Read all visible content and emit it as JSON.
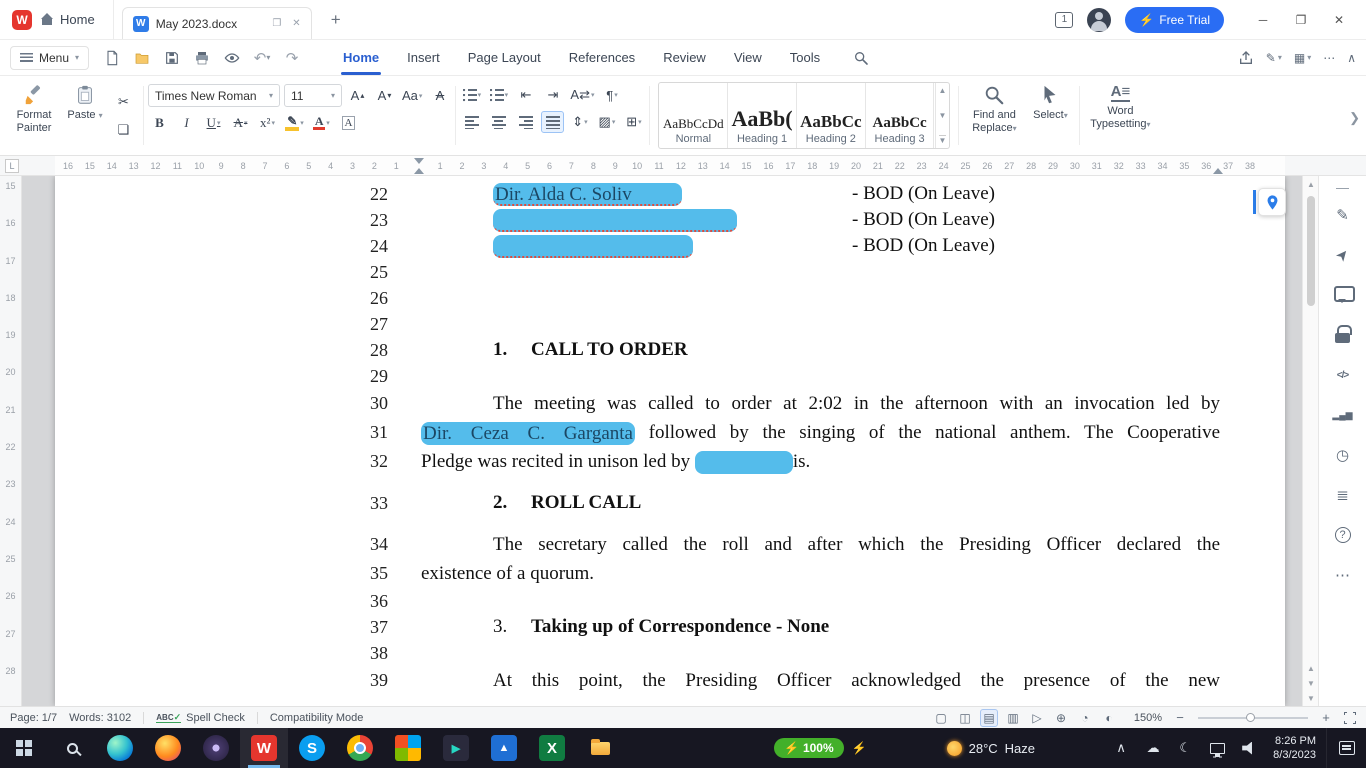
{
  "titlebar": {
    "workspace_tab_label": "Home",
    "document_tab_title": "May 2023.docx",
    "session_badge": "1",
    "free_trial_label": "Free Trial"
  },
  "menubar": {
    "menu_label": "Menu",
    "tabs": [
      {
        "label": "Home",
        "active": true
      },
      {
        "label": "Insert"
      },
      {
        "label": "Page Layout"
      },
      {
        "label": "References"
      },
      {
        "label": "Review"
      },
      {
        "label": "View"
      },
      {
        "label": "Tools"
      }
    ]
  },
  "ribbon": {
    "format_painter_label": "Format Painter",
    "paste_label": "Paste",
    "font_name_value": "Times New Roman",
    "font_size_value": "11",
    "styles": [
      {
        "preview": "AaBbCcDd",
        "label": "Normal"
      },
      {
        "preview": "AaBb(",
        "label": "Heading 1"
      },
      {
        "preview": "AaBbCc",
        "label": "Heading 2"
      },
      {
        "preview": "AaBbCc",
        "label": "Heading 3"
      }
    ],
    "find_replace_label": "Find and Replace",
    "select_label": "Select",
    "word_typesetting_label": "Word Typesetting"
  },
  "ruler": {
    "horizontal_numbers": [
      "16",
      "15",
      "14",
      "13",
      "12",
      "11",
      "10",
      "9",
      "8",
      "7",
      "6",
      "5",
      "4",
      "3",
      "2",
      "1",
      "",
      "1",
      "2",
      "3",
      "4",
      "5",
      "6",
      "7",
      "8",
      "9",
      "10",
      "11",
      "12",
      "13",
      "14",
      "15",
      "16",
      "17",
      "18",
      "19",
      "20",
      "21",
      "22",
      "23",
      "24",
      "25",
      "26",
      "27",
      "28",
      "29",
      "30",
      "31",
      "32",
      "33",
      "34",
      "35",
      "36",
      "37",
      "38"
    ],
    "vertical_numbers": [
      "15",
      "16",
      "17",
      "18",
      "19",
      "20",
      "21",
      "22",
      "23",
      "24",
      "25",
      "26",
      "27",
      "28"
    ]
  },
  "document": {
    "lines": [
      {
        "num": "22",
        "type": "roster",
        "text": "Dir. Alda C. Soliv",
        "hl_width": 189,
        "right": "- BOD (On Leave)",
        "squiggle": true
      },
      {
        "num": "23",
        "type": "roster",
        "text": "",
        "hl_width": 244,
        "right": "- BOD (On Leave)",
        "squiggle": true
      },
      {
        "num": "24",
        "type": "roster",
        "text": "",
        "hl_width": 200,
        "right": "- BOD (On Leave)",
        "squiggle": true
      },
      {
        "num": "25",
        "type": "empty"
      },
      {
        "num": "26",
        "type": "empty"
      },
      {
        "num": "27",
        "type": "empty"
      },
      {
        "num": "28",
        "type": "heading",
        "number": "1.",
        "text": "CALL TO ORDER"
      },
      {
        "num": "29",
        "type": "empty"
      },
      {
        "num": "30",
        "type": "body-first",
        "text": "The meeting was called to order at 2:02 in the afternoon with an invocation led by"
      },
      {
        "num": "31",
        "type": "body",
        "segments": [
          {
            "text": "Dir. Ceza C. Garganta",
            "hl": true,
            "hl_width": 214
          },
          {
            "text": " followed by the singing of the national anthem. The Cooperative"
          }
        ]
      },
      {
        "num": "32",
        "type": "body-last",
        "segments": [
          {
            "text": "Pledge was recited in unison led by "
          },
          {
            "text": "",
            "hl": true,
            "hl_width": 98
          },
          {
            "text": "is."
          }
        ]
      },
      {
        "num": "33",
        "type": "heading",
        "number": "2.",
        "text": "ROLL CALL",
        "gap_before": true
      },
      {
        "num": "34",
        "type": "body-first",
        "text": "The secretary called the roll and after which the Presiding Officer declared the",
        "gap_before": true
      },
      {
        "num": "35",
        "type": "body-last",
        "text": "existence of a quorum."
      },
      {
        "num": "36",
        "type": "empty"
      },
      {
        "num": "37",
        "type": "heading",
        "number": "3.",
        "text": "Taking up of Correspondence - None",
        "number_bold": false
      },
      {
        "num": "38",
        "type": "empty"
      },
      {
        "num": "39",
        "type": "body-first",
        "text": "At this point, the Presiding Officer acknowledged the presence of the new"
      }
    ]
  },
  "sidebar": {
    "tools": [
      {
        "name": "edit-pen",
        "glyph": "✎"
      },
      {
        "name": "select-cursor",
        "glyph": "➤"
      },
      {
        "name": "comment",
        "glyph": ""
      },
      {
        "name": "lock",
        "glyph": ""
      },
      {
        "name": "source-code",
        "glyph": "</>"
      },
      {
        "name": "chart",
        "glyph": "▂▄▆"
      },
      {
        "name": "history",
        "glyph": "◷"
      },
      {
        "name": "navigation-pane",
        "glyph": "≣"
      },
      {
        "name": "help",
        "glyph": "?"
      },
      {
        "name": "more",
        "glyph": "⋯"
      }
    ]
  },
  "statusbar": {
    "page_label": "Page: 1/7",
    "words_label": "Words: 3102",
    "spell_label": "Spell Check",
    "compatibility_label": "Compatibility Mode",
    "zoom_value": "150%",
    "view_icons": [
      {
        "name": "edit-tools",
        "glyph": "▢"
      },
      {
        "name": "side-by-side",
        "glyph": "◫"
      },
      {
        "name": "read-layout",
        "glyph": "▤",
        "active": true
      },
      {
        "name": "print-layout",
        "glyph": "▥"
      },
      {
        "name": "play-presentation",
        "glyph": "▷"
      },
      {
        "name": "web-layout",
        "glyph": "⊕"
      },
      {
        "name": "eye-protection",
        "glyph": "◔"
      },
      {
        "name": "night-mode",
        "glyph": "◐"
      }
    ]
  },
  "taskbar": {
    "apps": [
      {
        "name": "start"
      },
      {
        "name": "search"
      },
      {
        "name": "edge"
      },
      {
        "name": "firefox"
      },
      {
        "name": "tor-browser"
      },
      {
        "name": "wps-office",
        "glyph": "W",
        "active": true
      },
      {
        "name": "skype",
        "glyph": "S"
      },
      {
        "name": "chrome"
      },
      {
        "name": "office-hub"
      },
      {
        "name": "media-app",
        "glyph": "▶"
      },
      {
        "name": "photos",
        "glyph": "▲"
      },
      {
        "name": "excel",
        "glyph": "X"
      },
      {
        "name": "file-explorer"
      }
    ],
    "battery_label": "100%",
    "weather_temp": "28°C",
    "weather_cond": "Haze",
    "tray": [
      {
        "name": "hidden-icons",
        "glyph": "∧"
      },
      {
        "name": "cloud",
        "glyph": "☁"
      },
      {
        "name": "night-light",
        "glyph": "☾"
      },
      {
        "name": "network",
        "glyph": ""
      },
      {
        "name": "volume",
        "glyph": ""
      }
    ],
    "time": "8:26 PM",
    "date": "8/3/2023"
  }
}
